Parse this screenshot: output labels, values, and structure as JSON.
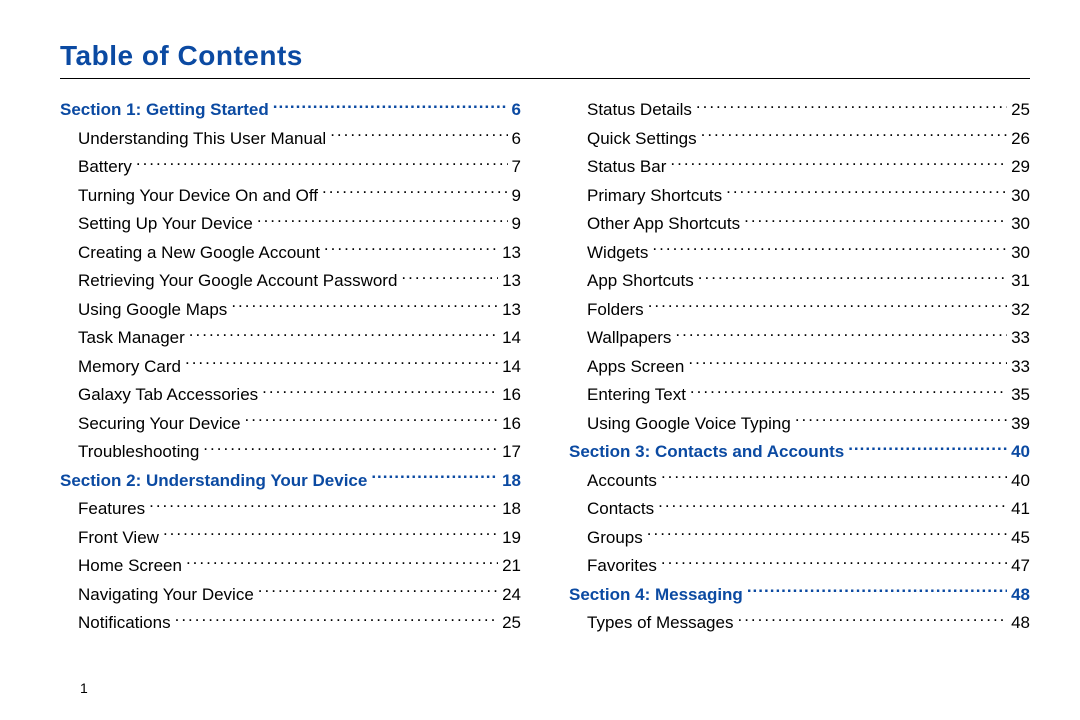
{
  "title": "Table of Contents",
  "footer_page": "1",
  "toc": [
    {
      "type": "section",
      "label": "Section 1:  Getting Started",
      "page": "6"
    },
    {
      "type": "entry",
      "label": "Understanding This User Manual",
      "page": "6"
    },
    {
      "type": "entry",
      "label": "Battery",
      "page": "7"
    },
    {
      "type": "entry",
      "label": "Turning Your Device On and Off",
      "page": "9"
    },
    {
      "type": "entry",
      "label": "Setting Up Your Device",
      "page": "9"
    },
    {
      "type": "entry",
      "label": "Creating a New Google Account",
      "page": "13"
    },
    {
      "type": "entry",
      "label": "Retrieving Your Google Account Password",
      "page": "13"
    },
    {
      "type": "entry",
      "label": "Using Google Maps",
      "page": "13"
    },
    {
      "type": "entry",
      "label": "Task Manager",
      "page": "14"
    },
    {
      "type": "entry",
      "label": "Memory Card",
      "page": "14"
    },
    {
      "type": "entry",
      "label": "Galaxy Tab Accessories",
      "page": "16"
    },
    {
      "type": "entry",
      "label": "Securing Your Device",
      "page": "16"
    },
    {
      "type": "entry",
      "label": "Troubleshooting",
      "page": "17"
    },
    {
      "type": "section",
      "label": "Section 2:  Understanding Your Device",
      "page": "18"
    },
    {
      "type": "entry",
      "label": "Features",
      "page": "18"
    },
    {
      "type": "entry",
      "label": "Front View",
      "page": "19"
    },
    {
      "type": "entry",
      "label": "Home Screen",
      "page": "21"
    },
    {
      "type": "entry",
      "label": "Navigating Your Device",
      "page": "24"
    },
    {
      "type": "entry",
      "label": "Notifications",
      "page": "25"
    },
    {
      "type": "entry",
      "label": "Status Details",
      "page": "25"
    },
    {
      "type": "entry",
      "label": "Quick Settings",
      "page": "26"
    },
    {
      "type": "entry",
      "label": "Status Bar",
      "page": "29"
    },
    {
      "type": "entry",
      "label": "Primary Shortcuts",
      "page": "30"
    },
    {
      "type": "entry",
      "label": "Other App Shortcuts",
      "page": "30"
    },
    {
      "type": "entry",
      "label": "Widgets",
      "page": "30"
    },
    {
      "type": "entry",
      "label": "App Shortcuts",
      "page": "31"
    },
    {
      "type": "entry",
      "label": "Folders",
      "page": "32"
    },
    {
      "type": "entry",
      "label": "Wallpapers",
      "page": "33"
    },
    {
      "type": "entry",
      "label": "Apps Screen",
      "page": "33"
    },
    {
      "type": "entry",
      "label": "Entering Text",
      "page": "35"
    },
    {
      "type": "entry",
      "label": "Using Google Voice Typing",
      "page": "39"
    },
    {
      "type": "section",
      "label": "Section 3:  Contacts and Accounts",
      "page": "40"
    },
    {
      "type": "entry",
      "label": "Accounts",
      "page": "40"
    },
    {
      "type": "entry",
      "label": "Contacts",
      "page": "41"
    },
    {
      "type": "entry",
      "label": "Groups",
      "page": "45"
    },
    {
      "type": "entry",
      "label": "Favorites",
      "page": "47"
    },
    {
      "type": "section",
      "label": "Section 4:  Messaging",
      "page": "48"
    },
    {
      "type": "entry",
      "label": "Types of Messages",
      "page": "48"
    }
  ]
}
